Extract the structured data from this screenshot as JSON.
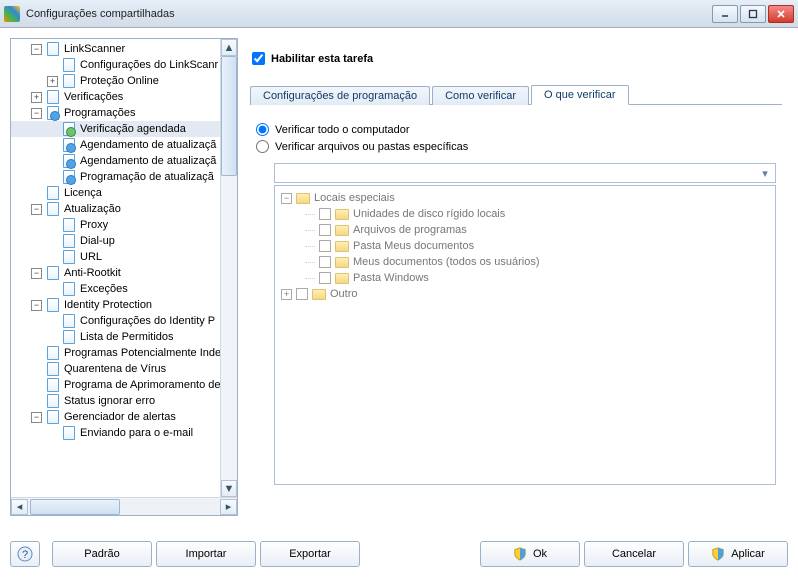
{
  "window": {
    "title": "Configurações compartilhadas"
  },
  "tree": [
    {
      "indent": 1,
      "exp": "-",
      "icon": "page",
      "label": "LinkScanner"
    },
    {
      "indent": 2,
      "exp": "",
      "icon": "page",
      "label": "Configurações do LinkScanr"
    },
    {
      "indent": 2,
      "exp": "+",
      "icon": "page",
      "label": "Proteção Online"
    },
    {
      "indent": 1,
      "exp": "+",
      "icon": "page",
      "label": "Verificações"
    },
    {
      "indent": 1,
      "exp": "-",
      "icon": "sched",
      "label": "Programações"
    },
    {
      "indent": 2,
      "exp": "",
      "icon": "sched-sel",
      "label": "Verificação agendada",
      "selected": true
    },
    {
      "indent": 2,
      "exp": "",
      "icon": "sched",
      "label": "Agendamento de atualizaçã"
    },
    {
      "indent": 2,
      "exp": "",
      "icon": "sched",
      "label": "Agendamento de atualizaçã"
    },
    {
      "indent": 2,
      "exp": "",
      "icon": "sched",
      "label": "Programação de atualizaçã"
    },
    {
      "indent": 1,
      "exp": "",
      "icon": "page",
      "label": "Licença"
    },
    {
      "indent": 1,
      "exp": "-",
      "icon": "page",
      "label": "Atualização"
    },
    {
      "indent": 2,
      "exp": "",
      "icon": "page",
      "label": "Proxy"
    },
    {
      "indent": 2,
      "exp": "",
      "icon": "page",
      "label": "Dial-up"
    },
    {
      "indent": 2,
      "exp": "",
      "icon": "page",
      "label": "URL"
    },
    {
      "indent": 1,
      "exp": "-",
      "icon": "page",
      "label": "Anti-Rootkit"
    },
    {
      "indent": 2,
      "exp": "",
      "icon": "page",
      "label": "Exceções"
    },
    {
      "indent": 1,
      "exp": "-",
      "icon": "page",
      "label": "Identity Protection"
    },
    {
      "indent": 2,
      "exp": "",
      "icon": "page",
      "label": "Configurações do Identity P"
    },
    {
      "indent": 2,
      "exp": "",
      "icon": "page",
      "label": "Lista de Permitidos"
    },
    {
      "indent": 1,
      "exp": "",
      "icon": "page",
      "label": "Programas Potencialmente Inde"
    },
    {
      "indent": 1,
      "exp": "",
      "icon": "page",
      "label": "Quarentena de Vírus"
    },
    {
      "indent": 1,
      "exp": "",
      "icon": "page",
      "label": "Programa de Aprimoramento de"
    },
    {
      "indent": 1,
      "exp": "",
      "icon": "page",
      "label": "Status ignorar erro"
    },
    {
      "indent": 1,
      "exp": "-",
      "icon": "page",
      "label": "Gerenciador de alertas"
    },
    {
      "indent": 2,
      "exp": "",
      "icon": "page",
      "label": "Enviando para o e-mail"
    }
  ],
  "enable_task": {
    "label": "Habilitar esta tarefa",
    "checked": true
  },
  "tabs": [
    {
      "label": "Configurações de programação",
      "active": false
    },
    {
      "label": "Como verificar",
      "active": false
    },
    {
      "label": "O que verificar",
      "active": true
    }
  ],
  "radios": {
    "whole": {
      "label": "Verificar todo o computador",
      "checked": true
    },
    "specific": {
      "label": "Verificar arquivos ou pastas específicas",
      "checked": false
    }
  },
  "locations": {
    "root": "Locais especiais",
    "items": [
      "Unidades de disco rígido locais",
      "Arquivos de programas",
      "Pasta Meus documentos",
      "Meus documentos (todos os usuários)",
      "Pasta Windows"
    ],
    "other": "Outro"
  },
  "footer": {
    "help": "?",
    "default": "Padrão",
    "import": "Importar",
    "export": "Exportar",
    "ok": "Ok",
    "cancel": "Cancelar",
    "apply": "Aplicar"
  }
}
